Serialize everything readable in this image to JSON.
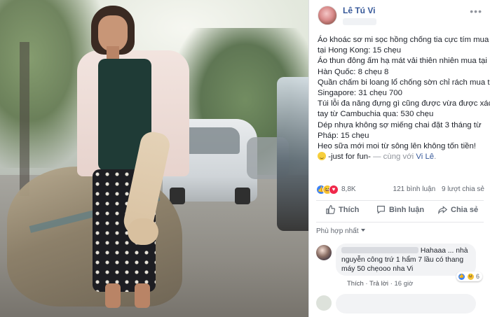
{
  "post": {
    "author": "Lê Tú Vi",
    "menu_icon": "more-dots-icon",
    "content_lines": [
      "Áo khoác sơ mi sọc hồng chống tia cực tím mua",
      "tại Hong Kong: 15 chẹu",
      "Áo thun đông ấm hạ mát vải thiên nhiên mua tại",
      "Hàn Quốc: 8 chẹu 8",
      "Quần chấm bi loang lổ chống sờn chỉ rách mua tại",
      "Singapore: 31 chẹu 700",
      "Túi lỗi đa năng đựng gì cũng được vừa được xách",
      "tay từ Cambuchia qua: 530 chẹu",
      "Dép nhựa không sợ miếng chai đặt 3 tháng từ",
      "Pháp: 15 chẹu",
      "Heo sữa mới moi từ sông lên không tốn tiền!"
    ],
    "tail": {
      "text": " -just for fun-",
      "with": " — cùng với ",
      "tagged": "Vi Lê",
      "end": "."
    }
  },
  "reactions": {
    "count": "8,8K",
    "comments": "121 bình luận",
    "shares": "9 lượt chia sẻ",
    "colors": {
      "like": "#3b82f6",
      "haha": "#f5c33b",
      "love": "#f0284a"
    }
  },
  "actions": {
    "like": "Thích",
    "comment": "Bình luận",
    "share": "Chia sẻ"
  },
  "sort": {
    "label": "Phù hợp nhất"
  },
  "comment": {
    "text_top": "Hahaaa ... nhà",
    "text_rest": "nguyễn công trứ 1 hẩm 7 lầu có thang máy 50 chẹooo nha Vi",
    "reaction_count": "6",
    "like": "Thích",
    "reply": "Trả lời",
    "time": "16 giờ",
    "separator": "·"
  }
}
